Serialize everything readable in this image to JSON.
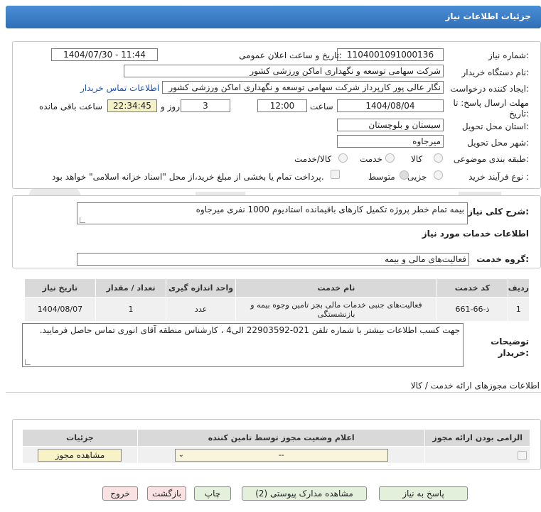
{
  "header": {
    "title": "جزئیات اطلاعات نیاز"
  },
  "form": {
    "need_number_label": "شماره نیاز:",
    "need_number": "1104001091000136",
    "announce_label": "تاریخ و ساعت اعلان عمومی:",
    "announce_value": "1404/07/30 - 11:44",
    "buyer_org_label": "نام دستگاه خریدار:",
    "buyer_org": "شرکت سهامی توسعه و نگهداری اماکن ورزشی کشور",
    "requester_label": "ایجاد کننده درخواست:",
    "requester": "نگار عالی پور کارپرداز شرکت سهامی توسعه و نگهداری اماکن ورزشی کشور",
    "buyer_contact_link": "اطلاعات تماس خریدار",
    "deadline_label": "مهلت ارسال پاسخ: تا تاریخ:",
    "deadline_date": "1404/08/04",
    "time_label": "ساعت",
    "deadline_time": "12:00",
    "days_value": "3",
    "days_label": "روز و",
    "remaining_time": "22:34:45",
    "remaining_label": "ساعت باقی مانده",
    "province_label": "استان محل تحویل:",
    "province": "سیستان و بلوچستان",
    "city_label": "شهر محل تحویل:",
    "city": "میرجاوه",
    "category_label": "طبقه بندی موضوعی:",
    "category_options": [
      "کالا",
      "خدمت",
      "کالا/خدمت"
    ],
    "process_label": "نوع فرآیند خرید :",
    "process_options": [
      "جزیی",
      "متوسط"
    ],
    "payment_note": "پرداخت تمام یا بخشی از مبلغ خرید،از محل \"اسناد خزانه اسلامی\" خواهد بود."
  },
  "description": {
    "label": "شرح کلی نیاز:",
    "value": "بیمه تمام خطر پروژه تکمیل کارهای باقیمانده استادیوم 1000 نفری میرجاوه"
  },
  "services": {
    "title": "اطلاعات خدمات مورد نیاز",
    "group_label": "گروه خدمت:",
    "group_value": "فعالیت‌های مالی و بیمه",
    "columns": [
      "ردیف",
      "کد خدمت",
      "نام خدمت",
      "واحد اندازه گیری",
      "تعداد / مقدار",
      "تاریخ نیاز"
    ],
    "rows": [
      [
        "1",
        "ذ-66-661",
        "فعالیت‌های جنبی خدمات مالی بجز تامین وجوه بیمه و بازنشستگی",
        "عدد",
        "1",
        "1404/08/07"
      ]
    ]
  },
  "buyer_notes": {
    "label": "توضیحات خریدار:",
    "value": "جهت کسب اطلاعات بیشتر با شماره تلفن 021-22903592 الی4 ، کارشناس منطقه آقای انوری تماس حاصل فرمایید."
  },
  "permits": {
    "title": "اطلاعات مجوزهای ارائه خدمت / کالا",
    "columns": [
      "الزامی بودن ارائه مجوز",
      "اعلام وضعیت مجوز توسط تامین کننده",
      "جزئیات"
    ],
    "select_value": "--",
    "view_button": "مشاهده مجوز"
  },
  "actions": {
    "reply": "پاسخ به نیاز",
    "docs": "مشاهده مدارک پیوستی (2)",
    "print": "چاپ",
    "back": "بازگشت",
    "exit": "خروج"
  },
  "colors": {
    "header": "#3b7fc9",
    "link": "#1a55b8",
    "remaining_bg": "#f5f1c6"
  }
}
